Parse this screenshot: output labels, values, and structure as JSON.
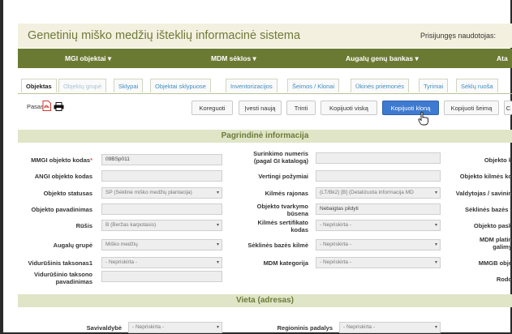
{
  "app": {
    "title": "Genetinių miško medžių išteklių informacinė sistema",
    "user_label": "Prisijungęs naudotojas:"
  },
  "topnav": [
    {
      "label": "MGI objektai",
      "chevron": "▾"
    },
    {
      "label": "MDM sėklos",
      "chevron": "▾"
    },
    {
      "label": "Augalų genų bankas",
      "chevron": "▾"
    },
    {
      "label": "Ata"
    }
  ],
  "tabs": [
    "Objektas",
    "Objektų grupė",
    "Sklypai",
    "Objektai sklypuose",
    "Inventorizacijos",
    "Šeimos / Klonai",
    "Ūkinės priemonės",
    "Tyrimai",
    "Sėklų ruoša"
  ],
  "toolbar": {
    "pasas_label": "Pasas:",
    "pdf_icon": "pdf-icon",
    "print_icon": "printer-icon",
    "buttons": [
      "Koreguoti",
      "Įvesti naują",
      "Trinti",
      "Kopijuoti viską",
      "Kopijuoti kloną",
      "Kopijuoti šeimą",
      "C"
    ]
  },
  "sections": {
    "main": "Pagrindinė informacija",
    "location": "Vieta (adresas)"
  },
  "left_fields": [
    {
      "label": "MMGI objekto kodas",
      "required": "*",
      "value": "09BSp011"
    },
    {
      "label": "ANGI objekto kodas",
      "value": ""
    },
    {
      "label": "Objekto statusas",
      "value": "SP (Sėklinė miško medžių plantacija)",
      "arrow": "▾"
    },
    {
      "label": "Objekto pavadinimas",
      "value": ""
    },
    {
      "label": "Rūšis",
      "value": "B (Beržas karpotasis)",
      "arrow": "▾"
    },
    {
      "label": "Augalų grupė",
      "value": "Miško medžių",
      "arrow": "▾"
    },
    {
      "label": "Vidurūšinis taksonas1",
      "value": "- Nepriskirta -",
      "arrow": "▾"
    },
    {
      "label1": "Vidurūšinio taksono",
      "label2": "pavadinimas",
      "value": ""
    }
  ],
  "mid_fields": [
    {
      "label1": "Surinkimo numeris",
      "label2": "(pagal GI katalogą)",
      "value": ""
    },
    {
      "label": "Vertingi požymiai",
      "value": ""
    },
    {
      "label": "Kilmės rajonas",
      "value": "(LT/Bk2) [B] (Detalizuota informacija MD",
      "arrow": "▾"
    },
    {
      "label1": "Objekto tvarkymo",
      "label2": "būsena",
      "value": "Nebaigtas pildyti"
    },
    {
      "label1": "Kilmės sertifikato",
      "label2": "kodas",
      "value": "- Nepriskirta -",
      "arrow": "▾"
    },
    {
      "label": "Sėklinės bazės kilmė",
      "value": "- Nepriskirta -",
      "arrow": "▾"
    },
    {
      "label": "MDM kategorija",
      "value": "- Nepriskirta -",
      "arrow": "▾"
    }
  ],
  "right_labels": [
    "Objekto k",
    "Objekto kilmės ko",
    "Valdytojas / savinin",
    "Sėklinės bazės t",
    "Objekto pask",
    "MDM platin",
    "galimy",
    "MMGB obje",
    "Rodo"
  ],
  "bottom": {
    "left_label": "Savivaldybė",
    "left_value": "- Nepriskirta -",
    "mid_label": "Regioninis padalys",
    "mid_value": "- Nepriskirta -",
    "arrow": "▾"
  }
}
